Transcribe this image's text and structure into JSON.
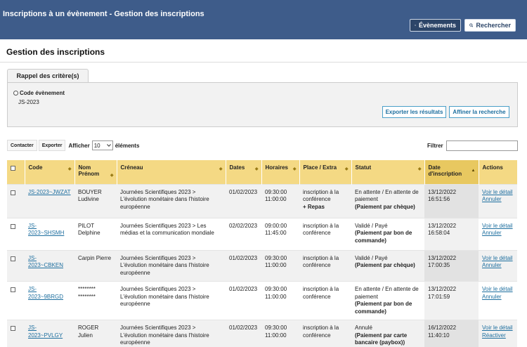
{
  "header": {
    "title": "Inscriptions à un évènement - Gestion des inscriptions",
    "events_button": "Évènements",
    "search_button": "Rechercher"
  },
  "page_title": "Gestion des inscriptions",
  "criteria": {
    "tab": "Rappel des critère(s)",
    "field_label": "Code évènement",
    "field_value": "JS-2023",
    "export_button": "Exporter les résultats",
    "refine_button": "Affiner la recherche"
  },
  "toolbar": {
    "contact_button": "Contacter",
    "export_button": "Exporter",
    "show_label": "Afficher",
    "show_value": "10",
    "elements_label": "éléments",
    "filter_label": "Filtrer"
  },
  "columns": [
    "Code",
    "Nom Prénom",
    "Créneau",
    "Dates",
    "Horaires",
    "Place / Extra",
    "Statut",
    "Date d'inscription",
    "Actions"
  ],
  "rows": [
    {
      "code": "JS-2023~JWZAT",
      "name": "BOUYER Ludivine",
      "slot": "Journées Scientifiques 2023 > L'évolution monétaire dans l'histoire européenne",
      "date": "01/02/2023",
      "time_start": "09:30:00",
      "time_end": "11:00:00",
      "place": "inscription à la conférence",
      "extra": "+ Repas",
      "status": "En attente / En attente de paiement",
      "status_detail": "(Paiement par chèque)",
      "reg_date": "13/12/2022",
      "reg_time": "16:51:56",
      "action1": "Voir le détail",
      "action2": "Annuler"
    },
    {
      "code": "JS-2023~SHSMH",
      "name": "PILOT Delphine",
      "slot": "Journées Scientifiques 2023 > Les médias et la communication mondiale",
      "date": "02/02/2023",
      "time_start": "09:00:00",
      "time_end": "11:45:00",
      "place": "inscription à la conférence",
      "extra": "",
      "status": "Validé / Payé",
      "status_detail": "(Paiement par bon de commande)",
      "reg_date": "13/12/2022",
      "reg_time": "16:58:04",
      "action1": "Voir le détail",
      "action2": "Annuler"
    },
    {
      "code": "JS-2023~CBKEN",
      "name": "Carpin Pierre",
      "slot": "Journées Scientifiques 2023 > L'évolution monétaire dans l'histoire européenne",
      "date": "01/02/2023",
      "time_start": "09:30:00",
      "time_end": "11:00:00",
      "place": "inscription à la conférence",
      "extra": "",
      "status": "Validé / Payé",
      "status_detail": "(Paiement par chèque)",
      "reg_date": "13/12/2022",
      "reg_time": "17:00:35",
      "action1": "Voir le détail",
      "action2": "Annuler"
    },
    {
      "code": "JS-2023~9BRGD",
      "name": "******** ********",
      "slot": "Journées Scientifiques 2023 > L'évolution monétaire dans l'histoire européenne",
      "date": "01/02/2023",
      "time_start": "09:30:00",
      "time_end": "11:00:00",
      "place": "inscription à la conférence",
      "extra": "",
      "status": "En attente / En attente de paiement",
      "status_detail": "(Paiement par bon de commande)",
      "reg_date": "13/12/2022",
      "reg_time": "17:01:59",
      "action1": "Voir le détail",
      "action2": "Annuler"
    },
    {
      "code": "JS-2023~PVLGY",
      "name": "ROGER Julien",
      "slot": "Journées Scientifiques 2023 > L'évolution monétaire dans l'histoire européenne",
      "date": "01/02/2023",
      "time_start": "09:30:00",
      "time_end": "11:00:00",
      "place": "inscription à la conférence",
      "extra": "",
      "status": "Annulé",
      "status_detail": "(Paiement par carte bancaire (paybox))",
      "reg_date": "16/12/2022",
      "reg_time": "11:40:10",
      "action1": "Voir le détail",
      "action2": "Réactiver"
    }
  ]
}
